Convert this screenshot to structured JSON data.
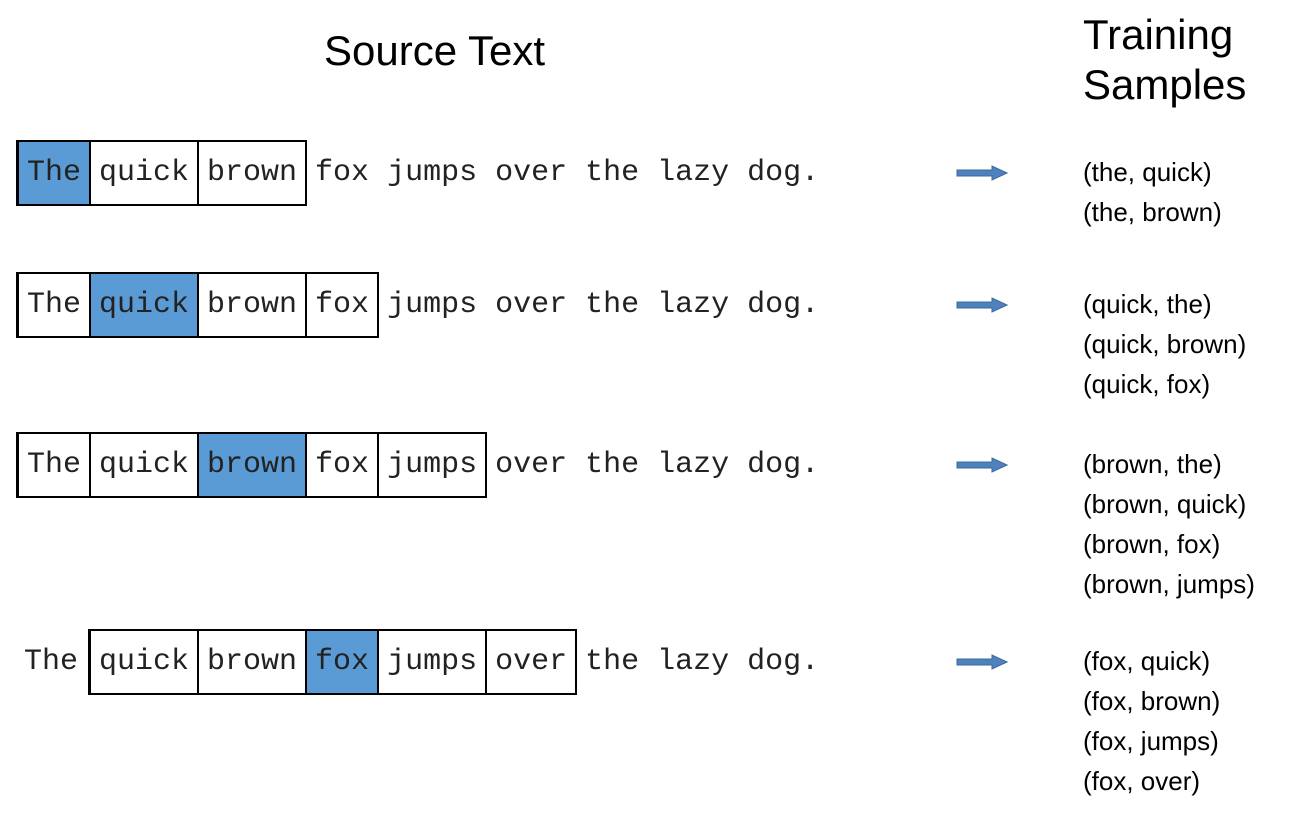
{
  "titles": {
    "source": "Source Text",
    "training_line1": "Training",
    "training_line2": "Samples"
  },
  "colors": {
    "target_fill": "#5b9bd5",
    "arrow": "#4f81bd"
  },
  "tokens": [
    "The",
    "quick",
    "brown",
    "fox",
    "jumps",
    "over",
    "the",
    "lazy",
    "dog."
  ],
  "rows": [
    {
      "target_index": 0,
      "window": [
        0,
        2
      ],
      "samples": [
        "(the, quick)",
        "(the, brown)"
      ]
    },
    {
      "target_index": 1,
      "window": [
        0,
        3
      ],
      "samples": [
        "(quick, the)",
        "(quick, brown)",
        "(quick, fox)"
      ]
    },
    {
      "target_index": 2,
      "window": [
        0,
        4
      ],
      "samples": [
        "(brown, the)",
        "(brown, quick)",
        "(brown, fox)",
        "(brown, jumps)"
      ]
    },
    {
      "target_index": 3,
      "window": [
        1,
        5
      ],
      "samples": [
        "(fox, quick)",
        "(fox, brown)",
        "(fox, jumps)",
        "(fox, over)"
      ]
    }
  ]
}
